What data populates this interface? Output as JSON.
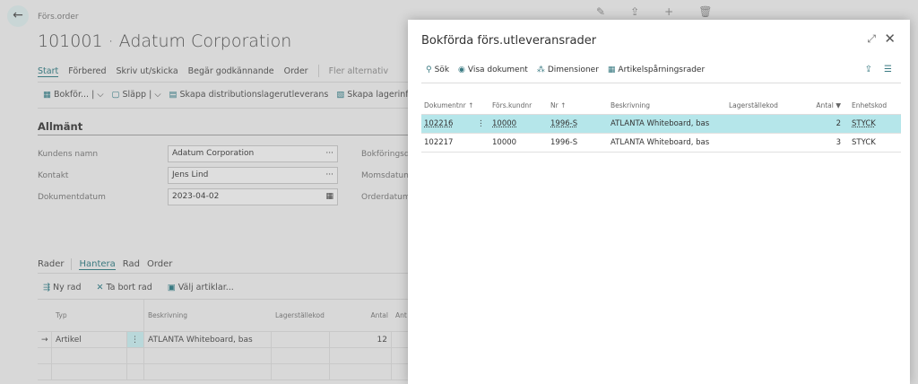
{
  "page": {
    "breadcrumb": "Förs.order",
    "title": "101001 · Adatum Corporation",
    "tabs": [
      "Start",
      "Förbered",
      "Skriv ut/skicka",
      "Begär godkännande",
      "Order"
    ],
    "more": "Fler alternativ",
    "actions": [
      "Bokför...",
      "Släpp",
      "Skapa distributionslagerutleverans",
      "Skapa lagerinförsel /"
    ],
    "section": "Allmänt",
    "fields": [
      {
        "label": "Kundens namn",
        "value": "Adatum Corporation"
      },
      {
        "label": "Kontakt",
        "value": "Jens Lind"
      },
      {
        "label": "Dokumentdatum",
        "value": "2023-04-02"
      }
    ],
    "right_labels": [
      "Bokföringsda",
      "Momsdatum",
      "Orderdatum"
    ],
    "lines": {
      "title": "Rader",
      "tabs": [
        "Hantera",
        "Rad",
        "Order"
      ],
      "actions": [
        "Ny rad",
        "Ta bort rad",
        "Välj artiklar..."
      ],
      "headers": [
        "Typ",
        "Beskrivning",
        "Lagerställekod",
        "Antal",
        "Ant"
      ],
      "rows": [
        {
          "type": "Artikel",
          "desc": "ATLANTA Whiteboard, bas",
          "qty": "12"
        }
      ]
    }
  },
  "dialog": {
    "title": "Bokförda förs.utleveransrader",
    "tools": [
      "Sök",
      "Visa dokument",
      "Dimensioner",
      "Artikelspårningsrader"
    ],
    "headers": [
      "Dokumentnr ↑",
      "Förs.kundnr",
      "Nr ↑",
      "Beskrivning",
      "Lagerställekod",
      "Antal",
      "Enhetskod"
    ],
    "rows": [
      {
        "doc": "102216",
        "cust": "10000",
        "no": "1996-S",
        "desc": "ATLANTA Whiteboard, bas",
        "loc": "",
        "qty": "2",
        "unit": "STYCK"
      },
      {
        "doc": "102217",
        "cust": "10000",
        "no": "1996-S",
        "desc": "ATLANTA Whiteboard, bas",
        "loc": "",
        "qty": "3",
        "unit": "STYCK"
      }
    ]
  },
  "colors": {
    "accent": "#3c7a80",
    "selected_row": "#b5e6ea"
  }
}
